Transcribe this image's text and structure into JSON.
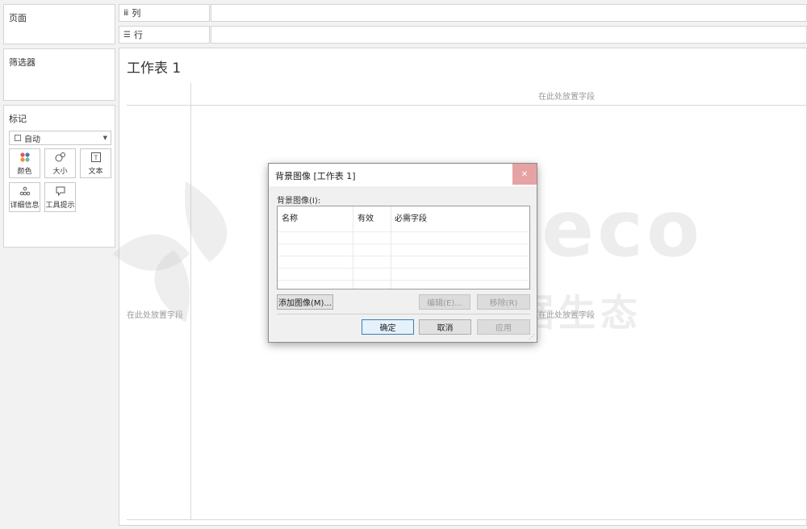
{
  "cards": {
    "pages": "页面",
    "filters": "筛选器",
    "marks": "标记"
  },
  "shelves": {
    "columns": {
      "icon": "iii",
      "label": "列"
    },
    "rows": {
      "icon": "☰",
      "label": "行"
    }
  },
  "marks": {
    "type": "自动",
    "buttons": [
      "颜色",
      "大小",
      "文本",
      "详细信息",
      "工具提示"
    ]
  },
  "worksheet": {
    "title": "工作表 1",
    "hint_top": "在此处放置字段",
    "hint_left": "在此处放置字段",
    "hint_right": "在此处放置字段"
  },
  "dialog": {
    "title": "背景图像 [工作表 1]",
    "list_label": "背景图像(I):",
    "columns": [
      "名称",
      "有效",
      "必需字段"
    ],
    "add_button": "添加图像(M)...",
    "edit_button": "编辑(E)...",
    "remove_button": "移除(R)",
    "ok_button": "确定",
    "cancel_button": "取消",
    "apply_button": "应用"
  },
  "watermark": {
    "brand": "DKM eco",
    "tagline": "优阅达大数据生态"
  },
  "colors": {
    "close_button": "#e6a3a3",
    "primary_border": "#3c7fb1"
  }
}
